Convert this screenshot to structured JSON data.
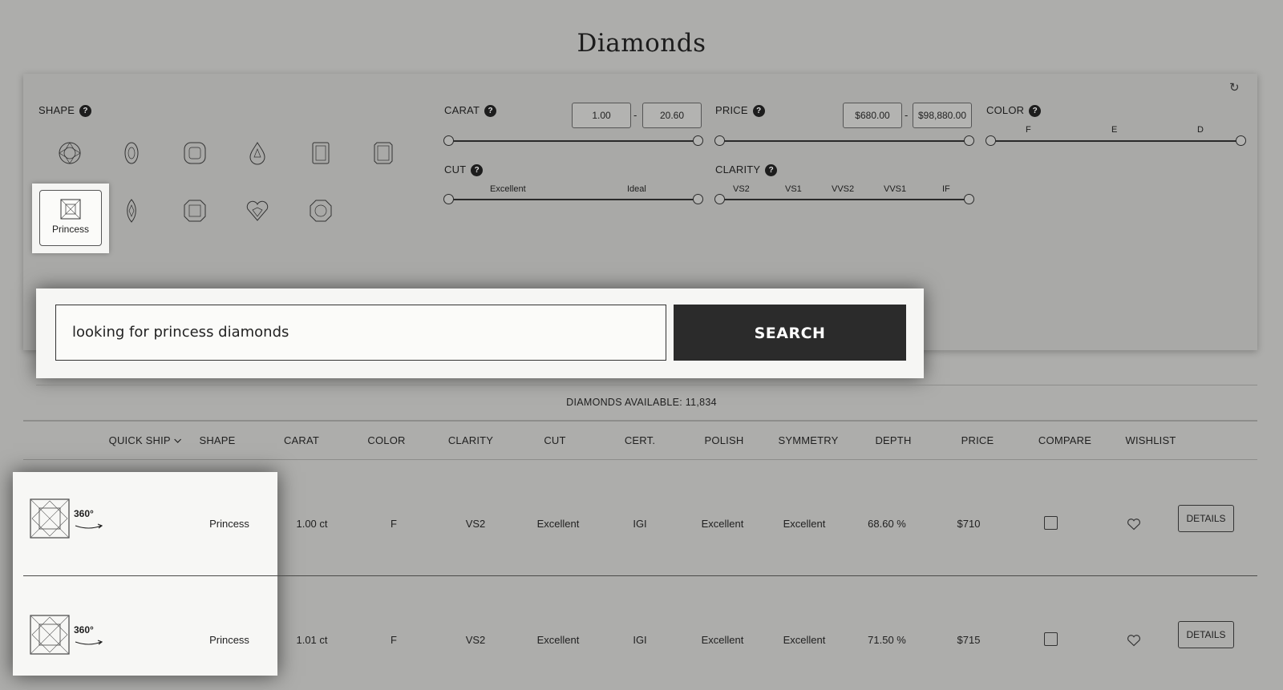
{
  "page": {
    "title": "Diamonds"
  },
  "filters": {
    "shape": {
      "label": "SHAPE",
      "help": "?",
      "selected_label": "Princess"
    },
    "carat": {
      "label": "CARAT",
      "help": "?",
      "min": "1.00",
      "max": "20.60",
      "separator": "-"
    },
    "price": {
      "label": "PRICE",
      "help": "?",
      "min": "$680.00",
      "max": "$98,880.00",
      "separator": "-"
    },
    "color": {
      "label": "COLOR",
      "help": "?",
      "ticks": [
        "F",
        "E",
        "D"
      ]
    },
    "cut": {
      "label": "CUT",
      "help": "?",
      "ticks": [
        "Excellent",
        "Ideal"
      ]
    },
    "clarity": {
      "label": "CLARITY",
      "help": "?",
      "ticks": [
        "VS2",
        "VS1",
        "VVS2",
        "VVS1",
        "IF"
      ]
    }
  },
  "search": {
    "value": "looking for princess diamonds",
    "button_label": "SEARCH"
  },
  "results": {
    "available_text": "DIAMONDS AVAILABLE: 11,834",
    "columns": {
      "quick_ship": "QUICK SHIP",
      "shape": "SHAPE",
      "carat": "CARAT",
      "color": "COLOR",
      "clarity": "CLARITY",
      "cut": "CUT",
      "cert": "CERT.",
      "polish": "POLISH",
      "symmetry": "SYMMETRY",
      "depth": "DEPTH",
      "price": "PRICE",
      "compare": "COMPARE",
      "wishlist": "WISHLIST"
    },
    "rows": [
      {
        "view_label": "360°",
        "shape": "Princess",
        "carat": "1.00 ct",
        "color": "F",
        "clarity": "VS2",
        "cut": "Excellent",
        "cert": "IGI",
        "polish": "Excellent",
        "symmetry": "Excellent",
        "depth": "68.60 %",
        "price": "$710",
        "details": "DETAILS"
      },
      {
        "view_label": "360°",
        "shape": "Princess",
        "carat": "1.01 ct",
        "color": "F",
        "clarity": "VS2",
        "cut": "Excellent",
        "cert": "IGI",
        "polish": "Excellent",
        "symmetry": "Excellent",
        "depth": "71.50 %",
        "price": "$715",
        "details": "DETAILS"
      }
    ]
  }
}
